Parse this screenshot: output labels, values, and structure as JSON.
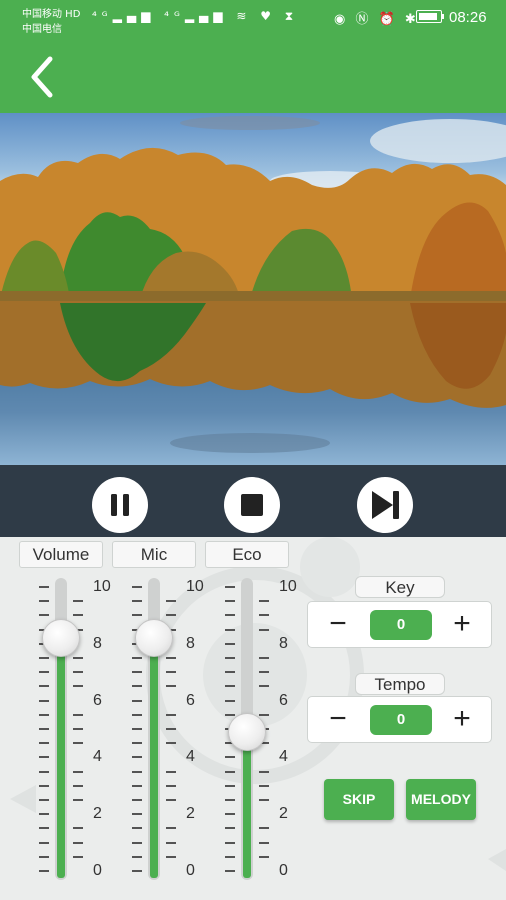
{
  "status_bar": {
    "carrier_1": "中国移动 HD",
    "carrier_2": "中国电信",
    "network_icons": "⁴ᴳ▂▄▆ ⁴ᴳ▂▄▆ ≋ ♥ ⧗",
    "system_icons": "◉ Ⓝ ⏰ ✱",
    "battery_level": 0.9,
    "time": "08:26"
  },
  "header": {
    "back_icon": "chevron-left-icon",
    "accent_color": "#4caf50"
  },
  "video": {
    "image": "autumn-lake-landscape",
    "controls": [
      {
        "name": "pause",
        "icon": "pause-icon"
      },
      {
        "name": "stop",
        "icon": "stop-icon"
      },
      {
        "name": "next",
        "icon": "skip-next-icon"
      }
    ]
  },
  "mixer": {
    "scale_labels": [
      "10",
      "8",
      "6",
      "4",
      "2",
      "0"
    ],
    "sliders": [
      {
        "label": "Volume",
        "level": 8.2
      },
      {
        "label": "Mic",
        "level": 8.2
      },
      {
        "label": "Eco",
        "level": 4.9
      }
    ]
  },
  "key": {
    "label": "Key",
    "value": "0",
    "minus": "−",
    "plus": "+"
  },
  "tempo": {
    "label": "Tempo",
    "value": "0",
    "minus": "−",
    "plus": "+"
  },
  "buttons": {
    "skip": "SKIP",
    "melody": "MELODY"
  }
}
